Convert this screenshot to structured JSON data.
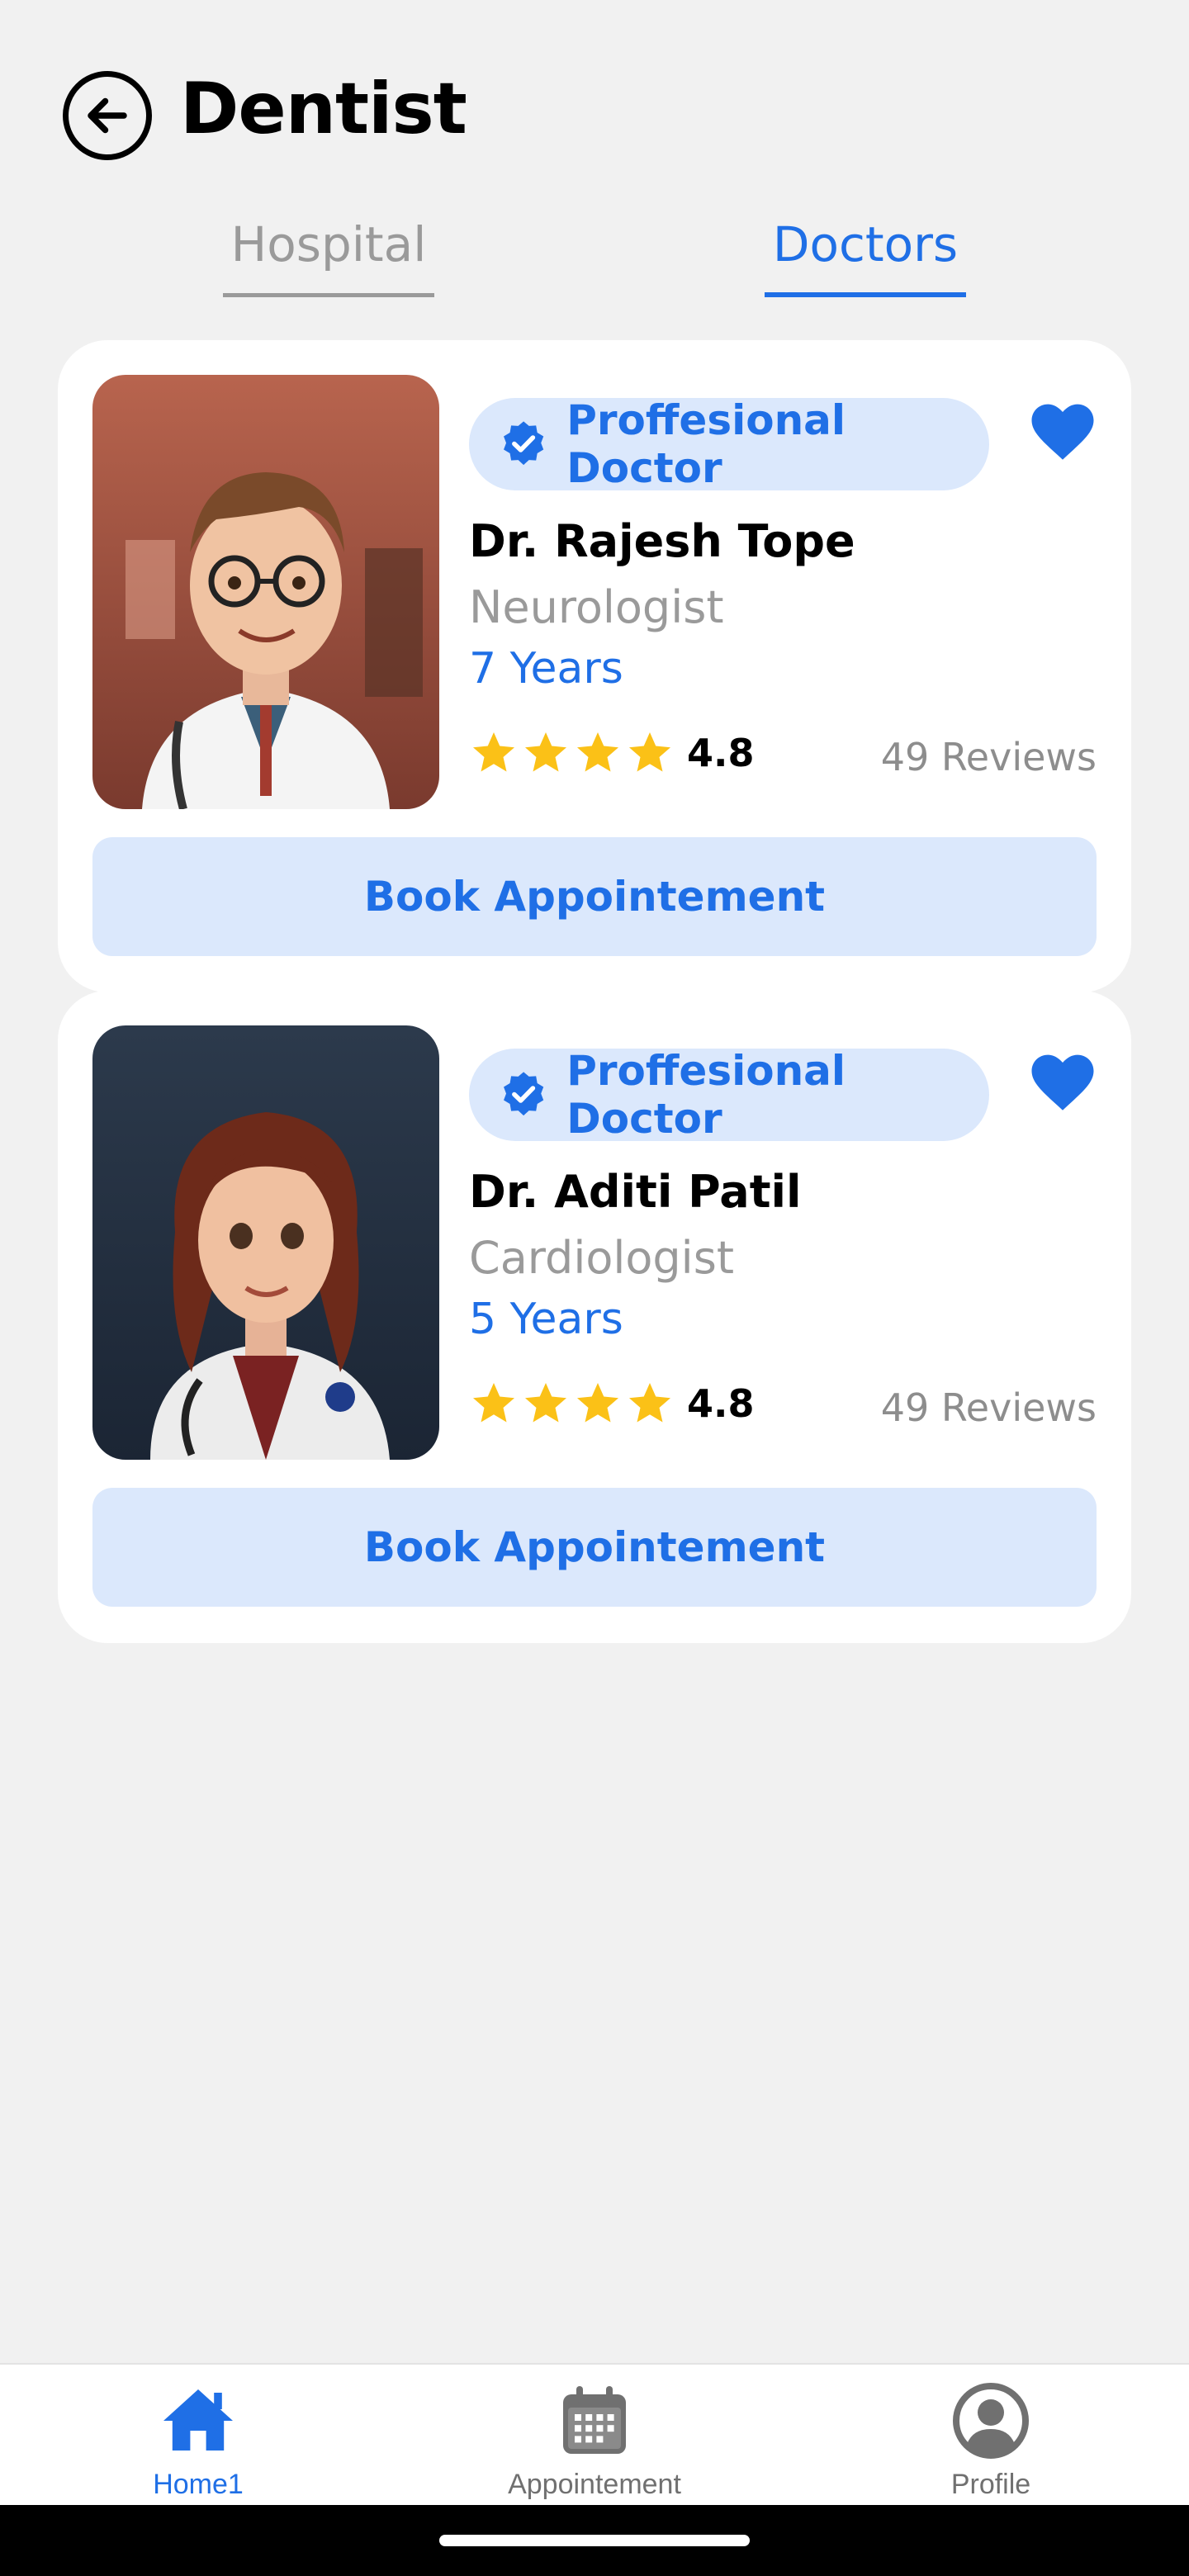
{
  "header": {
    "title": "Dentist",
    "back_icon": "arrow-left-circle-icon"
  },
  "tabs": [
    {
      "label": "Hospital",
      "active": false
    },
    {
      "label": "Doctors",
      "active": true
    }
  ],
  "colors": {
    "accent": "#1f6fe6",
    "accent_light": "#dbe8fc",
    "star": "#fbc117",
    "background": "#f1f1f1"
  },
  "doctors": [
    {
      "badge": "Proffesional Doctor",
      "name": "Dr. Rajesh Tope",
      "specialty": "Neurologist",
      "experience": "7 Years",
      "rating": "4.8",
      "stars": 4,
      "reviews": "49 Reviews",
      "favorite": true,
      "book_label": "Book Appointement"
    },
    {
      "badge": "Proffesional Doctor",
      "name": "Dr. Aditi Patil",
      "specialty": "Cardiologist",
      "experience": "5 Years",
      "rating": "4.8",
      "stars": 4,
      "reviews": "49 Reviews",
      "favorite": true,
      "book_label": "Book Appointement"
    }
  ],
  "bottom_nav": [
    {
      "label": "Home1",
      "icon": "home-icon",
      "active": true
    },
    {
      "label": "Appointement",
      "icon": "calendar-icon",
      "active": false
    },
    {
      "label": "Profile",
      "icon": "profile-icon",
      "active": false
    }
  ]
}
